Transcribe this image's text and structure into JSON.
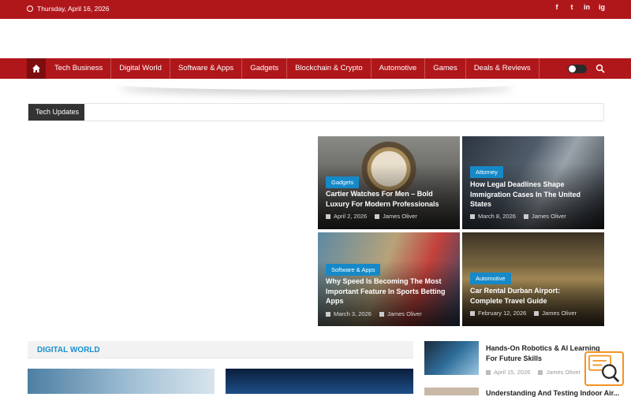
{
  "topbar": {
    "date": "Thursday, April 16, 2026",
    "socials": [
      "f",
      "t",
      "in",
      "ig"
    ]
  },
  "nav": {
    "items": [
      "Tech Business",
      "Digital World",
      "Software & Apps",
      "Gadgets",
      "Blockchain & Crypto",
      "Automotive",
      "Games",
      "Deals & Reviews"
    ]
  },
  "ticker": {
    "label": "Tech Updates"
  },
  "featured": [
    {
      "category": "Gadgets",
      "title": "Cartier Watches For Men – Bold Luxury For Modern Professionals",
      "date": "April 2, 2026",
      "author": "James Oliver"
    },
    {
      "category": "Attorney",
      "title": "How Legal Deadlines Shape Immigration Cases In The United States",
      "date": "March 8, 2026",
      "author": "James Oliver"
    },
    {
      "category": "Software & Apps",
      "title": "Why Speed Is Becoming The Most Important Feature In Sports Betting Apps",
      "date": "March 3, 2026",
      "author": "James Oliver"
    },
    {
      "category": "Automotive",
      "title": "Car Rental Durban Airport: Complete Travel Guide",
      "date": "February 12, 2026",
      "author": "James Oliver"
    }
  ],
  "section": {
    "title": "DIGITAL WORLD"
  },
  "sidebar": [
    {
      "title": "Hands-On Robotics & AI Learning For Future Skills",
      "date": "April 15, 2026",
      "author": "James Oliver"
    },
    {
      "title": "Understanding And Testing Indoor Air..."
    }
  ],
  "colors": {
    "brand": "#b0171b",
    "accent": "#1689c8",
    "dark": "#333333"
  }
}
